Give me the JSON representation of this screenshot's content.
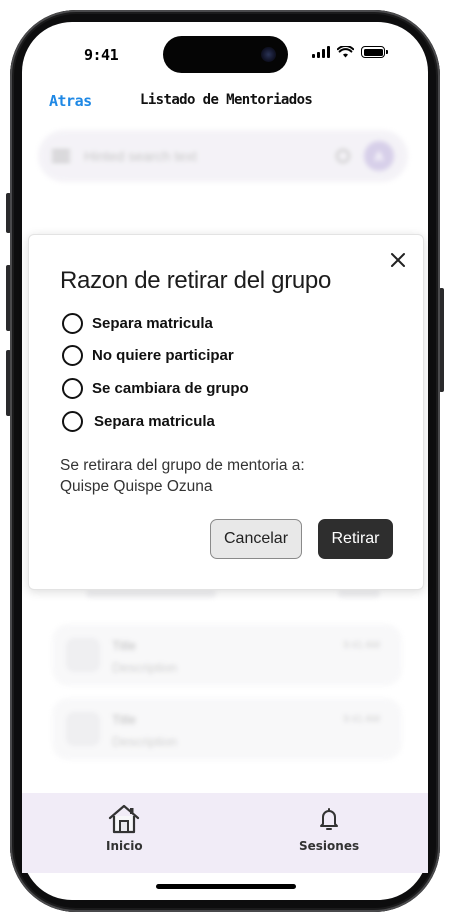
{
  "status_bar": {
    "time": "9:41"
  },
  "header": {
    "back_label": "Atras",
    "title": "Listado de Mentoriados"
  },
  "background": {
    "search": {
      "placeholder": "Hinted search text",
      "avatar_letter": "A"
    },
    "items": [
      {
        "title": "Title",
        "description": "Description",
        "time": "9:41 AM"
      },
      {
        "title": "Title",
        "description": "Description",
        "time": "9:41 AM"
      }
    ]
  },
  "dialog": {
    "title": "Razon de retirar del grupo",
    "options": [
      {
        "label": "Separa matricula",
        "selected": false
      },
      {
        "label": "No quiere participar",
        "selected": false
      },
      {
        "label": "Se cambiara de grupo",
        "selected": false
      },
      {
        "label": "Separa matricula",
        "selected": false
      }
    ],
    "message_line1": "Se retirara del grupo de mentoria a:",
    "message_line2": "Quispe Quispe Ozuna",
    "cancel_label": "Cancelar",
    "confirm_label": "Retirar"
  },
  "bottom_nav": {
    "items": [
      {
        "label": "Inicio",
        "icon": "home-icon"
      },
      {
        "label": "Sesiones",
        "icon": "bell-icon"
      }
    ]
  },
  "colors": {
    "accent_link": "#1e88e5",
    "confirm_button": "#2e2e2e",
    "nav_background": "#f1ecf7"
  }
}
